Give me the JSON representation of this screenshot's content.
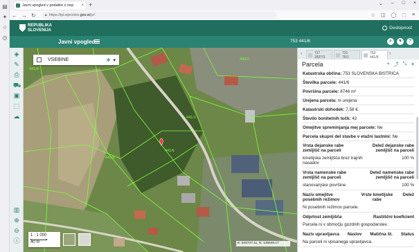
{
  "browser": {
    "tab_title": "Javni vpogled v podatke o nep",
    "url_prefix": "https://ipi.eprostor.",
    "url_domain": "gov.si",
    "url_suffix": "/jv/"
  },
  "site": {
    "logo_line1": "REPUBLIKA",
    "logo_line2": "SLOVENIJA",
    "accessibility_label": "Dostopnost"
  },
  "app": {
    "title": "Javni vpogled",
    "search_value": "753 441/6"
  },
  "map": {
    "layers_label": "VSEBINE",
    "scale_ratio": "1 : 1 000",
    "scale_bar_label": "40 m",
    "coords": "E: 545737.11, N: 135548.17",
    "parcel_labels": [
      "441/6",
      "441/6",
      "443/2",
      "441/1",
      "441/6"
    ]
  },
  "panel": {
    "tabs": [
      {
        "line1": "727",
        "line2": "2837/3"
      },
      {
        "line1": "731",
        "line2": "76/1"
      },
      {
        "line1": "753",
        "line2": "441/6"
      }
    ],
    "title": "Parcela",
    "rows": [
      {
        "key": "Katastrska občina:",
        "value": " 753 SLOVENSKA BISTRICA"
      },
      {
        "key": "Številka parcele:",
        "value": " 441/6"
      },
      {
        "key": "Površina parcele:",
        "value": " 8746 m²"
      },
      {
        "key": "Urejena parcela:",
        "value": " ni urejena"
      },
      {
        "key": "Katastrski dohodek:",
        "value": " 7,58 €"
      },
      {
        "key": "Število bonitetnih točk:",
        "value": " 42"
      },
      {
        "key": "Omejitve spreminjanja mej parcele:",
        "value": " Ne"
      },
      {
        "key": "Parcela skupni del stavbe v etažni lastnini:",
        "value": " Ne"
      }
    ],
    "table_dejanska": {
      "h1": "Vrsta dejanske rabe zemljišč na parceli",
      "h2": "Delež dejanske rabe zemljišč na parceli",
      "c1": "kmetijska zemljišča brez trajnih nasadov",
      "c2": "100 %"
    },
    "table_namenska": {
      "h1": "Vrsta namenske rabe zemljišč na parceli",
      "h2": "Delež namenske rabe zemljišč na parceli",
      "c1": "stanovanjske površine",
      "c2": "100 %"
    },
    "table_omejitve": {
      "h1": "Naziv omejitve posebnih režimov",
      "h2": "Vrste kmetijske rabe",
      "h3": "Delež",
      "c1": "Ni posebnih režimov parcele."
    },
    "table_odprtost": {
      "h1": "Odprtost zemljišča",
      "h2": "Rastiščni koeficient",
      "c1": "Parcela ni v območju gozdnih gospodarstev."
    },
    "table_upravljavci": {
      "h1": "Naziv upravljavca",
      "h2": "Naslov",
      "h3": "Matična št.",
      "h4": "Status",
      "c1": "Na parceli ni vpisanega upravljavca."
    }
  },
  "colors": {
    "header": "#1f6e5e",
    "appbar": "#2a8272",
    "parcel_lines": "#7cff3c"
  }
}
